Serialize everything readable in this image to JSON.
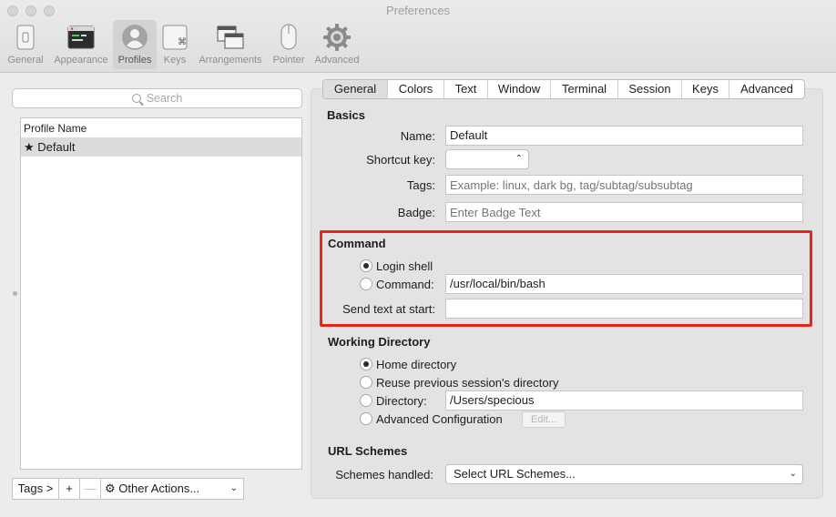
{
  "window": {
    "title": "Preferences"
  },
  "toolbar": {
    "items": [
      {
        "label": "General",
        "icon": "general-icon"
      },
      {
        "label": "Appearance",
        "icon": "appearance-icon"
      },
      {
        "label": "Profiles",
        "icon": "profiles-icon",
        "active": true
      },
      {
        "label": "Keys",
        "icon": "keys-icon"
      },
      {
        "label": "Arrangements",
        "icon": "arrangements-icon"
      },
      {
        "label": "Pointer",
        "icon": "pointer-icon"
      },
      {
        "label": "Advanced",
        "icon": "gear-icon"
      }
    ]
  },
  "left": {
    "search_placeholder": "Search",
    "list_header": "Profile Name",
    "profiles": [
      {
        "name": "★ Default",
        "selected": true
      }
    ],
    "bottom": {
      "tags": "Tags >",
      "add": "+",
      "remove": "—",
      "other_actions": "Other Actions..."
    }
  },
  "tabs": [
    "General",
    "Colors",
    "Text",
    "Window",
    "Terminal",
    "Session",
    "Keys",
    "Advanced"
  ],
  "selected_tab": "General",
  "basics": {
    "title": "Basics",
    "name_label": "Name:",
    "name_value": "Default",
    "shortcut_label": "Shortcut key:",
    "tags_label": "Tags:",
    "tags_placeholder": "Example: linux, dark bg, tag/subtag/subsubtag",
    "badge_label": "Badge:",
    "badge_placeholder": "Enter Badge Text"
  },
  "command": {
    "title": "Command",
    "login_shell": "Login shell",
    "command_label": "Command:",
    "command_value": "/usr/local/bin/bash",
    "send_text_label": "Send text at start:",
    "send_text_value": "",
    "selected": "login_shell"
  },
  "working_directory": {
    "title": "Working Directory",
    "home": "Home directory",
    "reuse": "Reuse previous session's directory",
    "directory_label": "Directory:",
    "directory_value": "/Users/specious",
    "advanced": "Advanced Configuration",
    "edit_button": "Edit...",
    "selected": "home"
  },
  "url_schemes": {
    "title": "URL Schemes",
    "label": "Schemes handled:",
    "select_value": "Select URL Schemes..."
  },
  "colors": {
    "highlight": "#e8241c"
  }
}
